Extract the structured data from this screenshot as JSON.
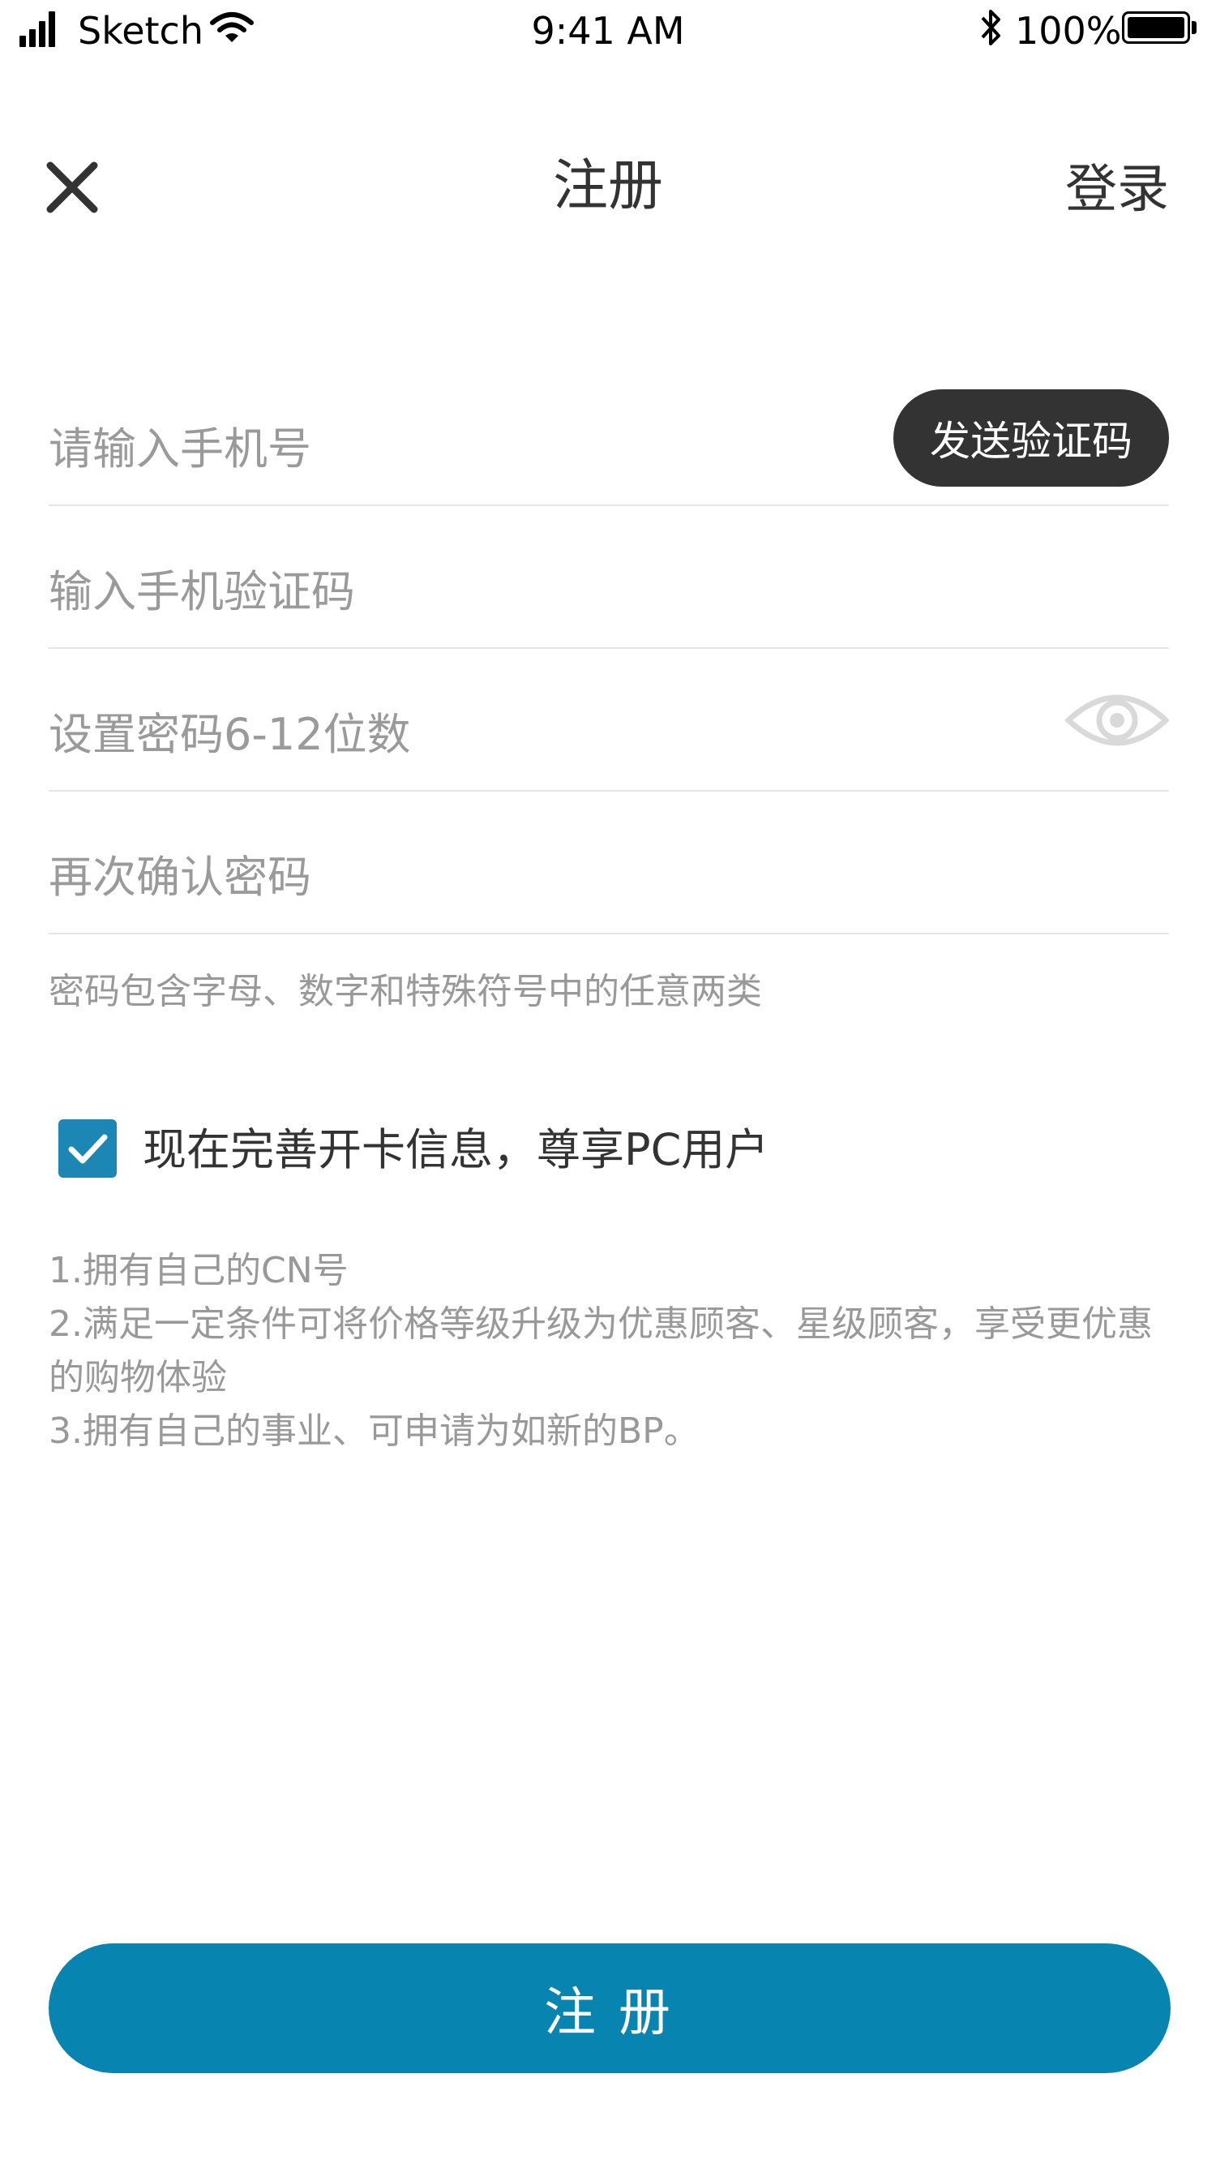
{
  "status_bar": {
    "carrier": "Sketch",
    "time": "9:41 AM",
    "battery": "100%",
    "icons": [
      "signal-icon",
      "wifi-icon",
      "bluetooth-icon",
      "battery-icon"
    ]
  },
  "nav": {
    "title": "注册",
    "login_label": "登录",
    "close_icon": "close-icon"
  },
  "form": {
    "phone_placeholder": "请输入手机号",
    "send_code_label": "发送验证码",
    "code_placeholder": "输入手机验证码",
    "password_placeholder": "设置密码6-12位数",
    "confirm_placeholder": "再次确认密码",
    "password_hint": "密码包含字母、数字和特殊符号中的任意两类",
    "eye_icon": "eye-icon"
  },
  "opt_in": {
    "checked": true,
    "label": "现在完善开卡信息，尊享PC用户"
  },
  "benefits": [
    "1.拥有自己的CN号",
    "2.满足一定条件可将价格等级升级为优惠顾客、星级顾客，享受更优惠的购物体验",
    "3.拥有自己的事业、可申请为如新的BP。"
  ],
  "submit_label": "注册",
  "colors": {
    "primary": "#0884b1",
    "checkbox": "#1c87b4",
    "send_button": "#333333",
    "placeholder": "#9a9a9a"
  }
}
